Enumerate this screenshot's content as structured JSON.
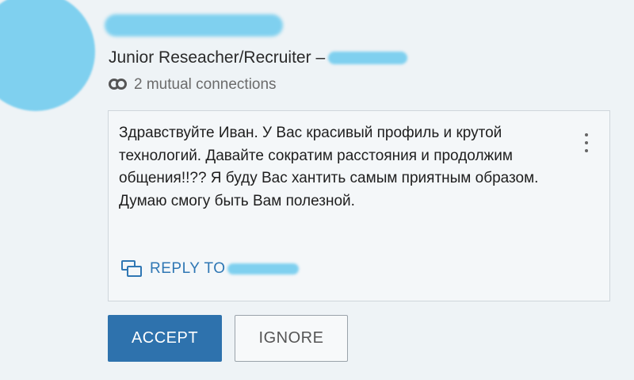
{
  "profile": {
    "headline": "Junior Reseacher/Recruiter –",
    "mutual_connections": "2 mutual connections",
    "mutual_icon": "mutual-connections-icon"
  },
  "message": {
    "text": "Здравствуйте Иван. У Вас красивый профиль и крутой технологий. Давайте сократим расстояния и продолжим общения!!?? Я буду Вас хантить самым приятным образом. Думаю смогу быть Вам полезной.",
    "reply_label": "REPLY TO",
    "reply_icon": "reply-chat-icon",
    "menu_icon": "more-vertical-icon"
  },
  "actions": {
    "accept_label": "ACCEPT",
    "ignore_label": "IGNORE"
  },
  "colors": {
    "accent": "#2e72ad",
    "reply_link": "#2f77b4",
    "redaction": "#7fd0ef"
  }
}
